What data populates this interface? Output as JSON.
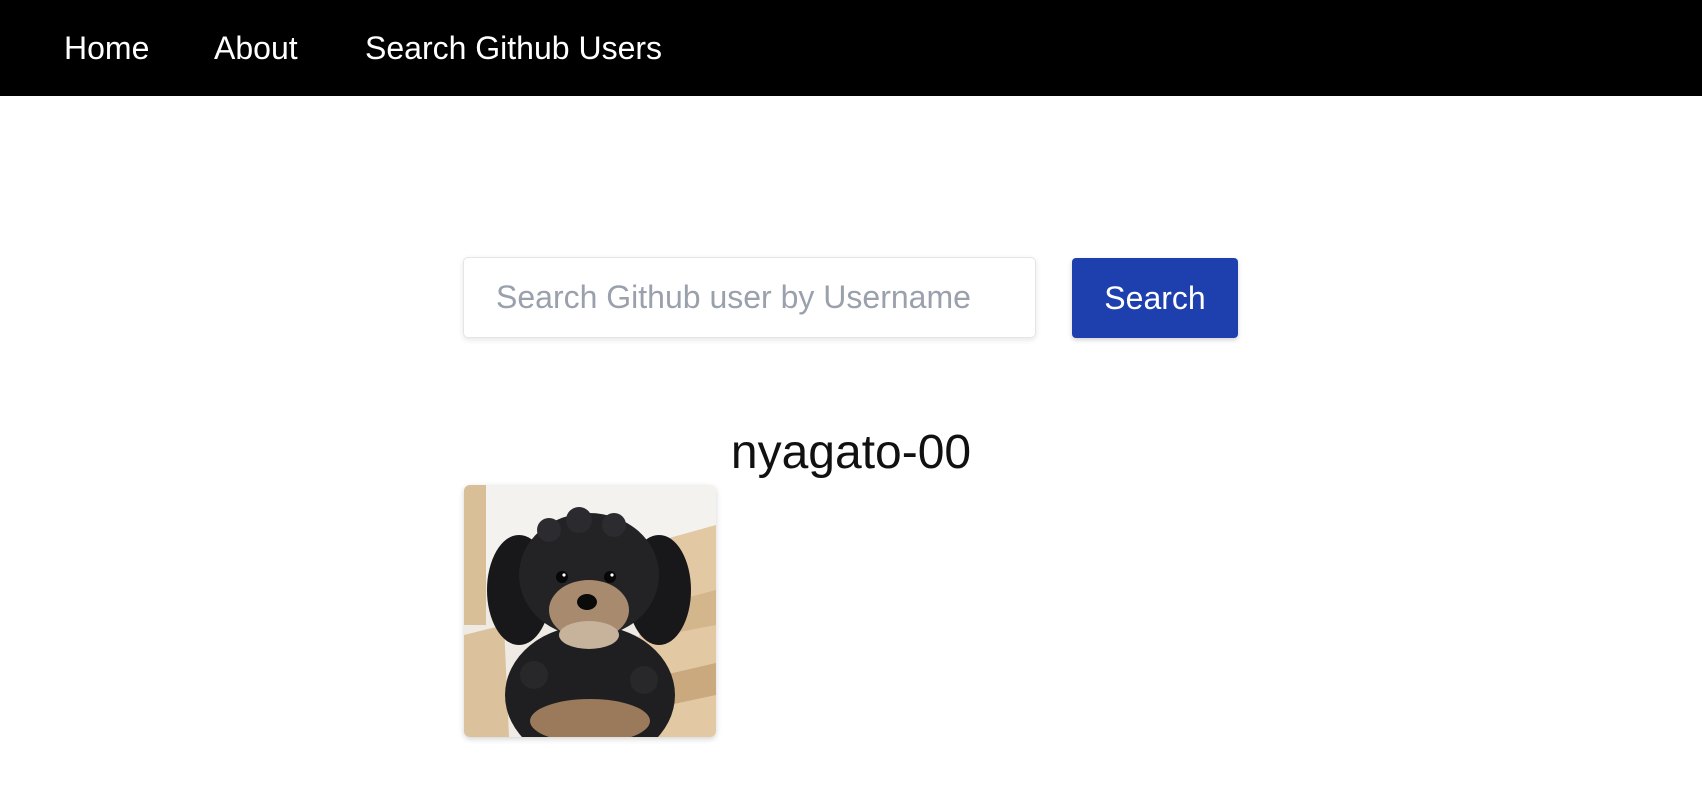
{
  "nav": {
    "items": [
      {
        "label": "Home"
      },
      {
        "label": "About"
      },
      {
        "label": "Search Github Users"
      }
    ]
  },
  "search": {
    "value": "",
    "placeholder": "Search Github user by Username",
    "button_label": "Search"
  },
  "result": {
    "username": "nyagato-00",
    "avatar_subject": "photo of a small black and tan poodle-mix dog"
  },
  "colors": {
    "navbar_bg": "#000000",
    "button_bg": "#1e40af",
    "placeholder": "#9aa1ad"
  }
}
